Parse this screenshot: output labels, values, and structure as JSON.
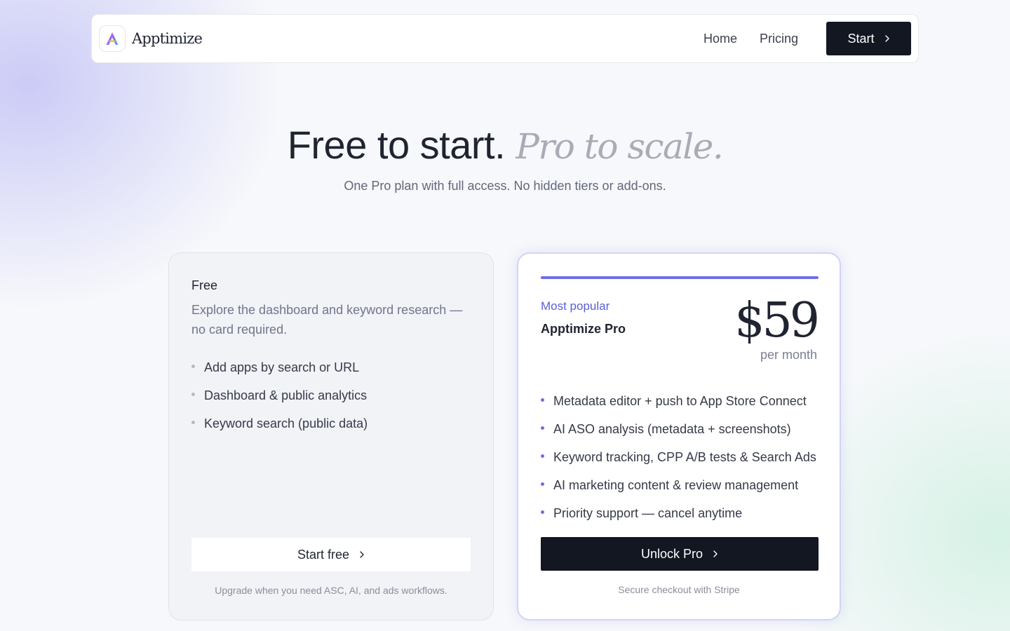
{
  "nav": {
    "brand": "Apptimize",
    "links": [
      "Home",
      "Pricing"
    ],
    "start_label": "Start"
  },
  "hero": {
    "title_main": "Free to start.",
    "title_accent": "Pro to scale.",
    "subtitle": "One Pro plan with full access. No hidden tiers or add-ons."
  },
  "free_plan": {
    "name": "Free",
    "description": "Explore the dashboard and keyword research — no card required.",
    "features": [
      "Add apps by search or URL",
      "Dashboard & public analytics",
      "Keyword search (public data)"
    ],
    "cta": "Start free",
    "note": "Upgrade when you need ASC, AI, and ads workflows."
  },
  "pro_plan": {
    "badge": "Most popular",
    "name": "Apptimize Pro",
    "price": "$59",
    "period": "per month",
    "features": [
      "Metadata editor + push to App Store Connect",
      "AI ASO analysis (metadata + screenshots)",
      "Keyword tracking, CPP A/B tests & Search Ads",
      "AI marketing content & review management",
      "Priority support — cancel anytime"
    ],
    "cta": "Unlock Pro",
    "note": "Secure checkout with Stripe"
  },
  "colors": {
    "accent": "#6c70e0",
    "dark_button": "#121722"
  },
  "icons": {
    "logo": "apptimize-logo-icon",
    "chevron": "chevron-right-icon"
  }
}
